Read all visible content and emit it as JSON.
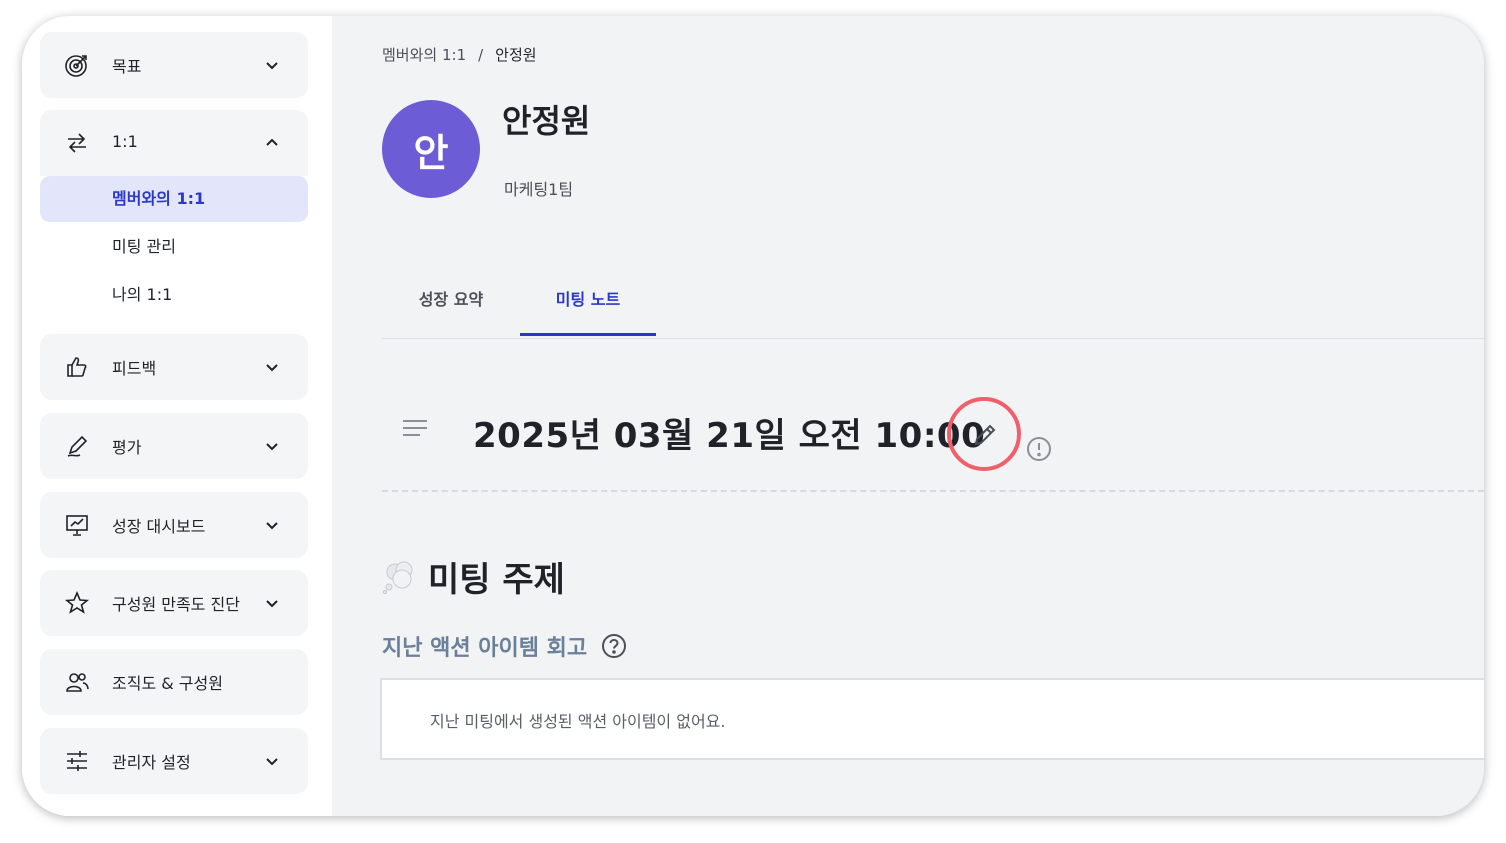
{
  "sidebar": {
    "goal": {
      "label": "목표",
      "icon": "target-icon"
    },
    "one_on_one": {
      "label": "1:1",
      "icon": "swap-arrows-icon",
      "items": [
        {
          "label": "멤버와의 1:1",
          "active": true
        },
        {
          "label": "미팅 관리",
          "active": false
        },
        {
          "label": "나의 1:1",
          "active": false
        }
      ]
    },
    "feedback": {
      "label": "피드백",
      "icon": "thumbs-up-icon"
    },
    "evaluation": {
      "label": "평가",
      "icon": "pen-icon"
    },
    "growth_dashboard": {
      "label": "성장 대시보드",
      "icon": "presentation-chart-icon"
    },
    "satisfaction": {
      "label": "구성원 만족도 진단",
      "icon": "star-icon"
    },
    "org_chart": {
      "label": "조직도 & 구성원",
      "icon": "users-icon"
    },
    "admin_settings": {
      "label": "관리자 설정",
      "icon": "sliders-icon"
    }
  },
  "breadcrumb": {
    "parent": "멤버와의 1:1",
    "separator": "/",
    "current": "안정원"
  },
  "profile": {
    "avatar_initial": "안",
    "avatar_color": "#6c5cd6",
    "name": "안정원",
    "team": "마케팅1팀"
  },
  "tabs": [
    {
      "label": "성장 요약",
      "active": false
    },
    {
      "label": "미팅 노트",
      "active": true
    }
  ],
  "meeting_note": {
    "title": "2025년 03월 21일 오전 10:00"
  },
  "topic": {
    "heading": "미팅 주제",
    "review_heading": "지난 액션 아이템 회고",
    "empty_message": "지난 미팅에서 생성된 액션 아이템이 없어요."
  },
  "colors": {
    "accent": "#2b38c9",
    "highlight_circle": "#f0606a"
  }
}
